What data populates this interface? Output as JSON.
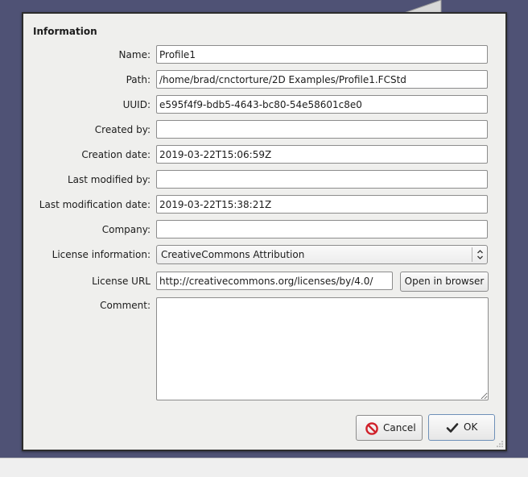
{
  "dialog": {
    "section_title": "Information",
    "fields": {
      "name": {
        "label": "Name:",
        "value": "Profile1"
      },
      "path": {
        "label": "Path:",
        "value": "/home/brad/cnctorture/2D Examples/Profile1.FCStd"
      },
      "uuid": {
        "label": "UUID:",
        "value": "e595f4f9-bdb5-4643-bc80-54e58601c8e0"
      },
      "created_by": {
        "label": "Created by:",
        "value": ""
      },
      "creation_date": {
        "label": "Creation date:",
        "value": "2019-03-22T15:06:59Z"
      },
      "last_modified_by": {
        "label": "Last modified by:",
        "value": ""
      },
      "last_modification_date": {
        "label": "Last modification date:",
        "value": "2019-03-22T15:38:21Z"
      },
      "company": {
        "label": "Company:",
        "value": ""
      },
      "license_information": {
        "label": "License information:",
        "selected": "CreativeCommons Attribution"
      },
      "license_url": {
        "label": "License URL",
        "value": "http://creativecommons.org/licenses/by/4.0/",
        "button_label": "Open in browser"
      },
      "comment": {
        "label": "Comment:",
        "value": ""
      }
    },
    "buttons": {
      "cancel_label": "Cancel",
      "ok_label": "OK"
    }
  },
  "icons": {
    "cancel": "cancel-icon",
    "ok": "checkmark-icon",
    "select": "updown-arrows-icon"
  },
  "colors": {
    "desktop_background": "#4f5275",
    "dialog_background": "#efefed",
    "cancel_icon": "#d0202a"
  }
}
